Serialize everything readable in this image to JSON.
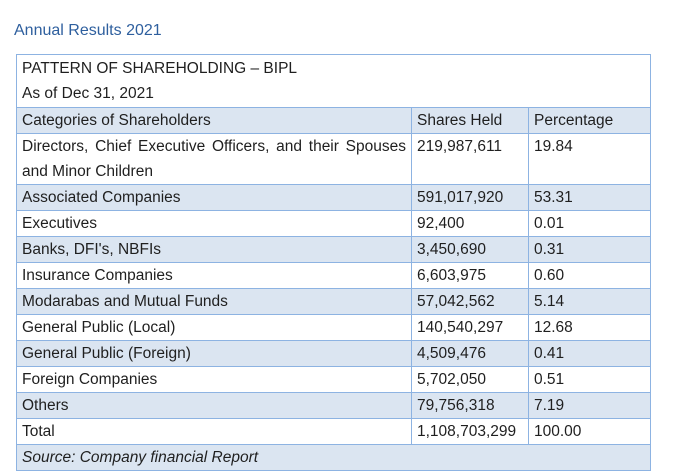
{
  "header": {
    "title": "Annual Results 2021"
  },
  "table": {
    "title": "PATTERN OF SHAREHOLDING – BIPL",
    "subtitle": "As of Dec 31, 2021",
    "columns": [
      "Categories of Shareholders",
      "Shares Held",
      "Percentage"
    ],
    "rows": [
      [
        "Directors, Chief Executive Officers, and their Spouses and Minor Children",
        "219,987,611",
        "19.84"
      ],
      [
        "Associated Companies",
        "591,017,920",
        "53.31"
      ],
      [
        "Executives",
        "92,400",
        "0.01"
      ],
      [
        "Banks, DFI's, NBFIs",
        "3,450,690",
        "0.31"
      ],
      [
        "Insurance Companies",
        "6,603,975",
        "0.60"
      ],
      [
        "Modarabas and Mutual Funds",
        "57,042,562",
        "5.14"
      ],
      [
        "General Public (Local)",
        "140,540,297",
        "12.68"
      ],
      [
        "General Public (Foreign)",
        "4,509,476",
        "0.41"
      ],
      [
        "Foreign Companies",
        "5,702,050",
        "0.51"
      ],
      [
        "Others",
        "79,756,318",
        "7.19"
      ],
      [
        "Total",
        "1,108,703,299",
        "100.00"
      ]
    ],
    "source": "Source: Company financial Report"
  },
  "colors": {
    "header_text": "#2e5f9e",
    "border": "#8db3e2",
    "shade": "#dbe5f1"
  }
}
